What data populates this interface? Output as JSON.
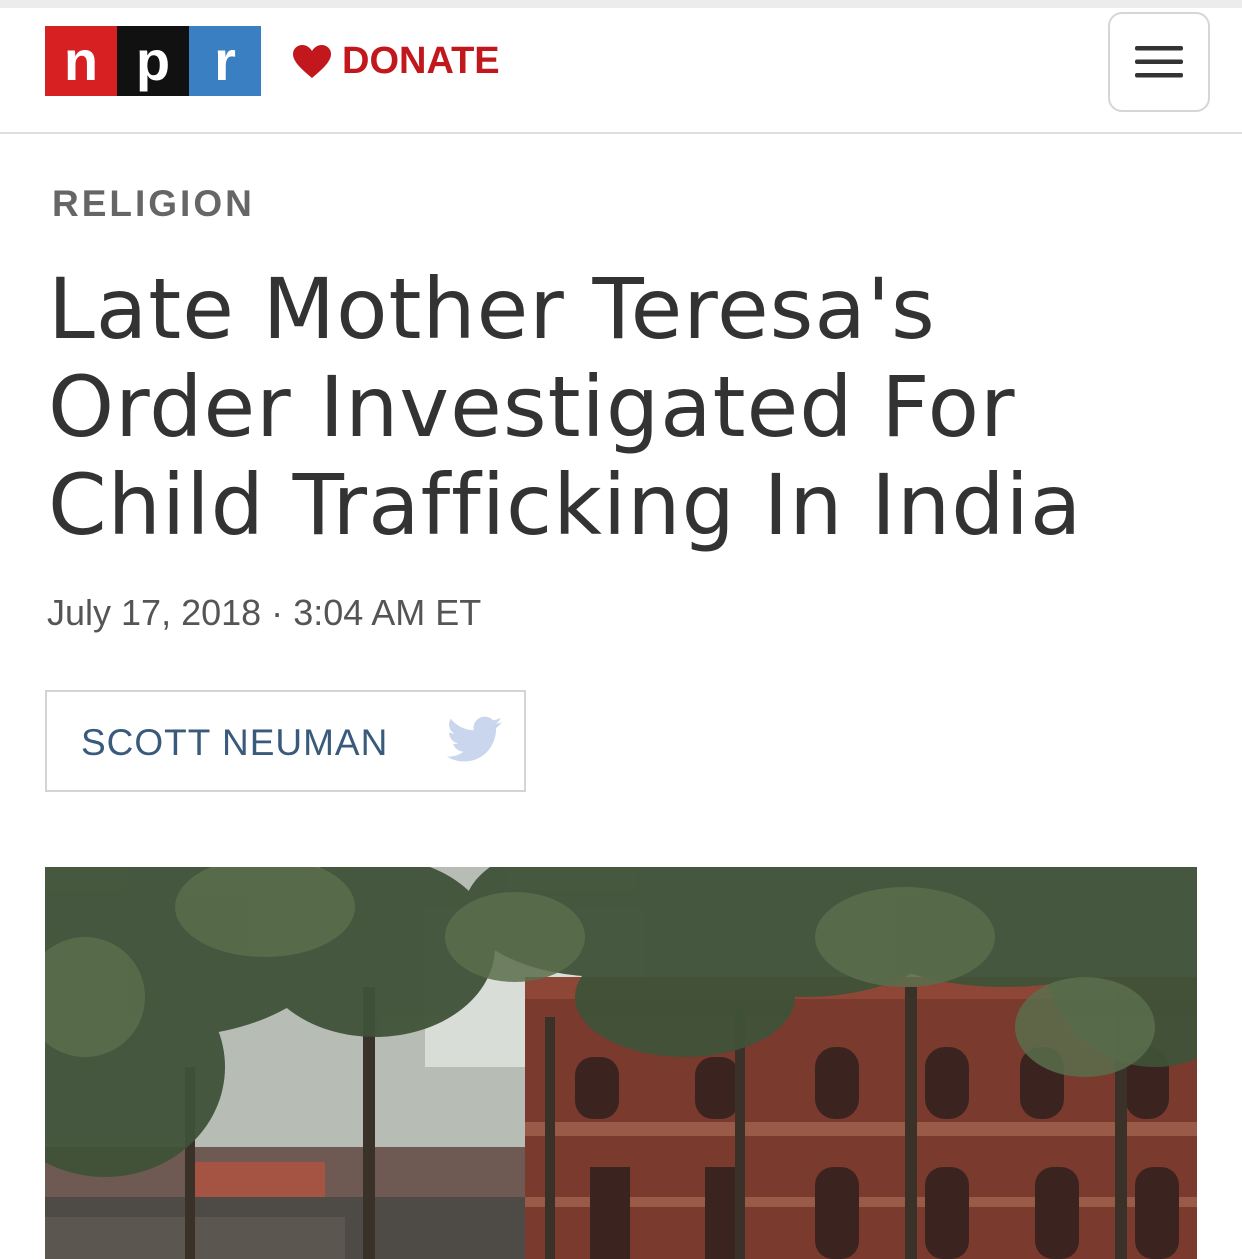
{
  "header": {
    "logo_letters": [
      "n",
      "p",
      "r"
    ],
    "donate_label": "DONATE",
    "donate_icon": "heart-icon",
    "menu_icon": "hamburger-menu-icon"
  },
  "article": {
    "category": "RELIGION",
    "headline": "Late Mother Teresa's Order Investigated For Child Trafficking In India",
    "date": "July 17, 2018",
    "separator": "·",
    "time": "3:04 AM ET",
    "author": "SCOTT NEUMAN",
    "author_icon": "twitter-icon"
  },
  "colors": {
    "npr_red": "#d62021",
    "npr_black": "#111111",
    "npr_blue": "#3a7fc2",
    "donate_red": "#c2171d",
    "byline_blue": "#3a5a7c"
  }
}
